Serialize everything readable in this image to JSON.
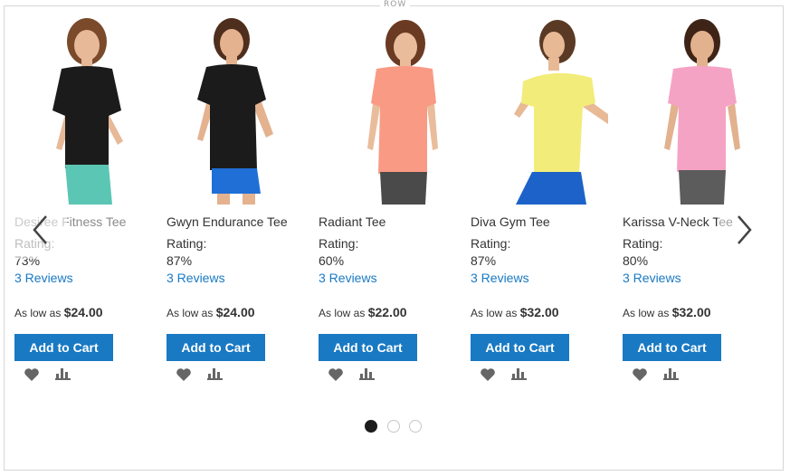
{
  "row": {
    "label": "ROW"
  },
  "products": [
    {
      "name": "Desiree Fitness Tee",
      "rating_label": "Rating:",
      "rating": "73%",
      "reviews": "3 Reviews",
      "price_prefix": "As low as",
      "price": "$24.00",
      "cart_label": "Add to Cart",
      "top_color": "#1b1b1b",
      "bottom_color": "#5bc6b3"
    },
    {
      "name": "Gwyn Endurance Tee",
      "rating_label": "Rating:",
      "rating": "87%",
      "reviews": "3 Reviews",
      "price_prefix": "As low as",
      "price": "$24.00",
      "cart_label": "Add to Cart",
      "top_color": "#1b1b1b",
      "bottom_color": "#1f6fd6"
    },
    {
      "name": "Radiant Tee",
      "rating_label": "Rating:",
      "rating": "60%",
      "reviews": "3 Reviews",
      "price_prefix": "As low as",
      "price": "$22.00",
      "cart_label": "Add to Cart",
      "top_color": "#f99a84",
      "bottom_color": "#4a4a4a"
    },
    {
      "name": "Diva Gym Tee",
      "rating_label": "Rating:",
      "rating": "87%",
      "reviews": "3 Reviews",
      "price_prefix": "As low as",
      "price": "$32.00",
      "cart_label": "Add to Cart",
      "top_color": "#f2ec7a",
      "bottom_color": "#1d62c9"
    },
    {
      "name": "Karissa V-Neck Tee",
      "rating_label": "Rating:",
      "rating": "80%",
      "reviews": "3 Reviews",
      "price_prefix": "As low as",
      "price": "$32.00",
      "cart_label": "Add to Cart",
      "top_color": "#f5a3c4",
      "bottom_color": "#5c5c5c"
    }
  ],
  "icons": {
    "prev": "chevron-left-icon",
    "next": "chevron-right-icon",
    "wishlist": "heart-icon",
    "compare": "bar-chart-icon"
  },
  "slider": {
    "page_count": 3,
    "active_page": 1
  },
  "colors": {
    "accent": "#1979c3",
    "link": "#1979c3",
    "dot_active": "#1c1c1c"
  }
}
